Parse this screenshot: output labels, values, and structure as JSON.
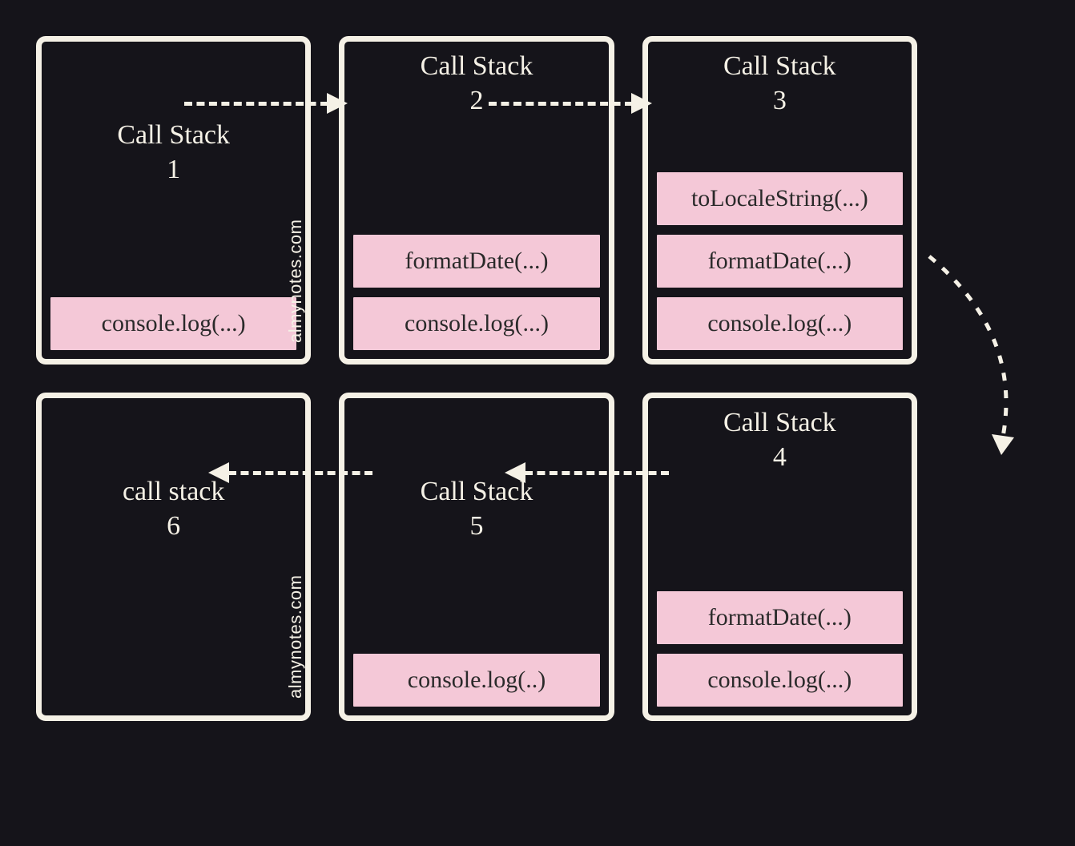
{
  "panels": {
    "p1": {
      "title": "Call Stack\n1",
      "frames": [
        "console.log(...)"
      ]
    },
    "p2": {
      "title": "Call Stack\n2",
      "frames": [
        "formatDate(...)",
        "console.log(...)"
      ]
    },
    "p3": {
      "title": "Call Stack\n3",
      "frames": [
        "toLocaleString(...)",
        "formatDate(...)",
        "console.log(...)"
      ]
    },
    "p4": {
      "title": "Call Stack\n4",
      "frames": [
        "formatDate(...)",
        "console.log(...)"
      ]
    },
    "p5": {
      "title": "Call Stack\n5",
      "frames": [
        "console.log(..)"
      ]
    },
    "p6": {
      "title": "call stack\n6",
      "frames": []
    }
  },
  "watermark": "almynotes.com",
  "colors": {
    "bg": "#15141a",
    "stroke": "#f5f1e6",
    "frame": "#f4c8d7"
  }
}
